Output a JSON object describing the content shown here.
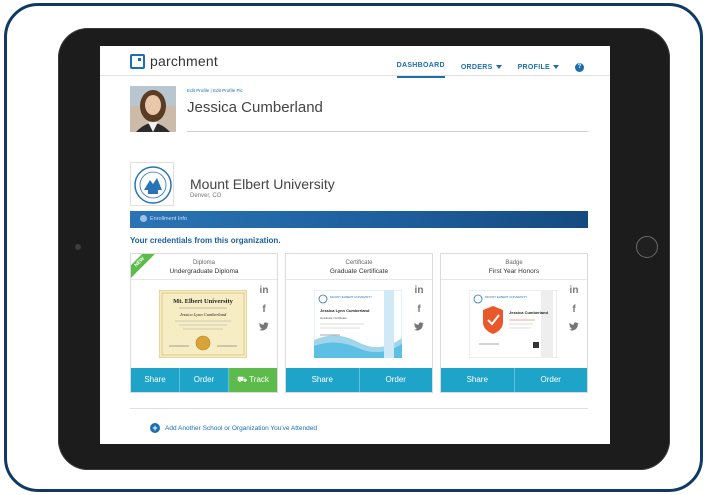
{
  "app": {
    "logo_text": "parchment",
    "nav": {
      "dashboard": "DASHBOARD",
      "orders": "ORDERS",
      "profile": "PROFILE",
      "help": "?"
    }
  },
  "profile": {
    "links": "Edit Profile  |  Edit Profile Pic",
    "name": "Jessica Cumberland"
  },
  "organization": {
    "name": "Mount Elbert University",
    "location": "Denver, CO",
    "enrollment_label": "Enrollment Info",
    "credentials_heading": "Your credentials from this organization."
  },
  "credentials": [
    {
      "type": "Diploma",
      "title": "Undergraduate Diploma",
      "badge": "NEW",
      "actions": [
        "Share",
        "Order",
        "Track"
      ]
    },
    {
      "type": "Certificate",
      "title": "Graduate Certificate",
      "actions": [
        "Share",
        "Order"
      ]
    },
    {
      "type": "Badge",
      "title": "First Year Honors",
      "actions": [
        "Share",
        "Order"
      ]
    }
  ],
  "diploma_doc": {
    "school": "Mt. Elbert University",
    "name": "Jessica Lynn Cumberland"
  },
  "certificate_doc": {
    "school": "MOUNT ELBERT UNIVERSITY",
    "name": "Jessica Lynn Cumberland",
    "subtitle": "Graduate Certificate"
  },
  "badge_doc": {
    "school": "MOUNT ELBERT UNIVERSITY",
    "name": "Jessica Cumberland"
  },
  "social": {
    "linkedin": "in",
    "facebook": "f",
    "twitter": "t"
  },
  "add_school": {
    "icon": "+",
    "label": "Add Another School or Organization You've Attended"
  },
  "colors": {
    "brand_blue": "#1b6fb0",
    "action_teal": "#1ea3c9",
    "track_green": "#5cbb4a",
    "frame_navy": "#0f3a64"
  }
}
